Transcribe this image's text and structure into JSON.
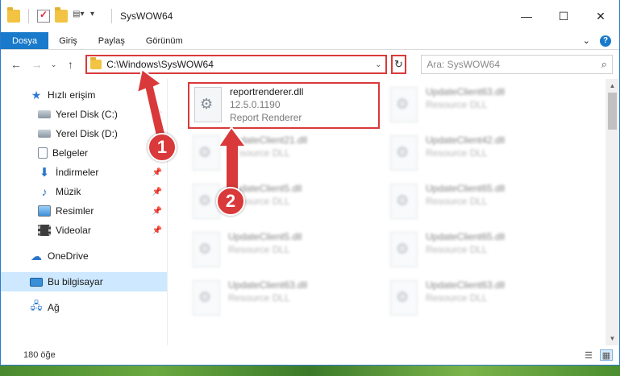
{
  "window": {
    "title": "SysWOW64"
  },
  "ribbon": {
    "tabs": [
      "Dosya",
      "Giriş",
      "Paylaş",
      "Görünüm"
    ]
  },
  "address": {
    "path": "C:\\Windows\\SysWOW64",
    "search_placeholder": "Ara: SysWOW64"
  },
  "sidebar": {
    "quick_access": "Hızlı erişim",
    "items": [
      {
        "label": "Yerel Disk (C:)",
        "icon": "drive-icon",
        "pinned": true
      },
      {
        "label": "Yerel Disk (D:)",
        "icon": "drive-icon",
        "pinned": true
      },
      {
        "label": "Belgeler",
        "icon": "documents-icon",
        "pinned": true
      },
      {
        "label": "İndirmeler",
        "icon": "download-icon",
        "pinned": true
      },
      {
        "label": "Müzik",
        "icon": "music-icon",
        "pinned": true
      },
      {
        "label": "Resimler",
        "icon": "pictures-icon",
        "pinned": true
      },
      {
        "label": "Videolar",
        "icon": "videos-icon",
        "pinned": true
      }
    ],
    "onedrive": "OneDrive",
    "this_pc": "Bu bilgisayar",
    "network": "Ağ"
  },
  "files": [
    {
      "name": "reportrenderer.dll",
      "line2": "12.5.0.1190",
      "line3": "Report Renderer",
      "highlighted": true
    },
    {
      "name": "UpdateClient63.dll",
      "line2": "Resource DLL"
    },
    {
      "name": "UpdateClient21.dll",
      "line2": "Resource DLL"
    },
    {
      "name": "UpdateClient42.dll",
      "line2": "Resource DLL"
    },
    {
      "name": "UpdateClient5.dll",
      "line2": "Resource DLL"
    },
    {
      "name": "UpdateClient65.dll",
      "line2": "Resource DLL"
    },
    {
      "name": "UpdateClient5.dll",
      "line2": "Resource DLL"
    },
    {
      "name": "UpdateClient65.dll",
      "line2": "Resource DLL"
    },
    {
      "name": "UpdateClient63.dll",
      "line2": "Resource DLL"
    },
    {
      "name": "UpdateClient63.dll",
      "line2": "Resource DLL"
    }
  ],
  "status": {
    "count": "180 öğe"
  },
  "annotations": {
    "badge1": "1",
    "badge2": "2"
  },
  "colors": {
    "accent": "#1979ca",
    "highlight_red": "#d9393a",
    "selected_bg": "#cde8ff"
  }
}
